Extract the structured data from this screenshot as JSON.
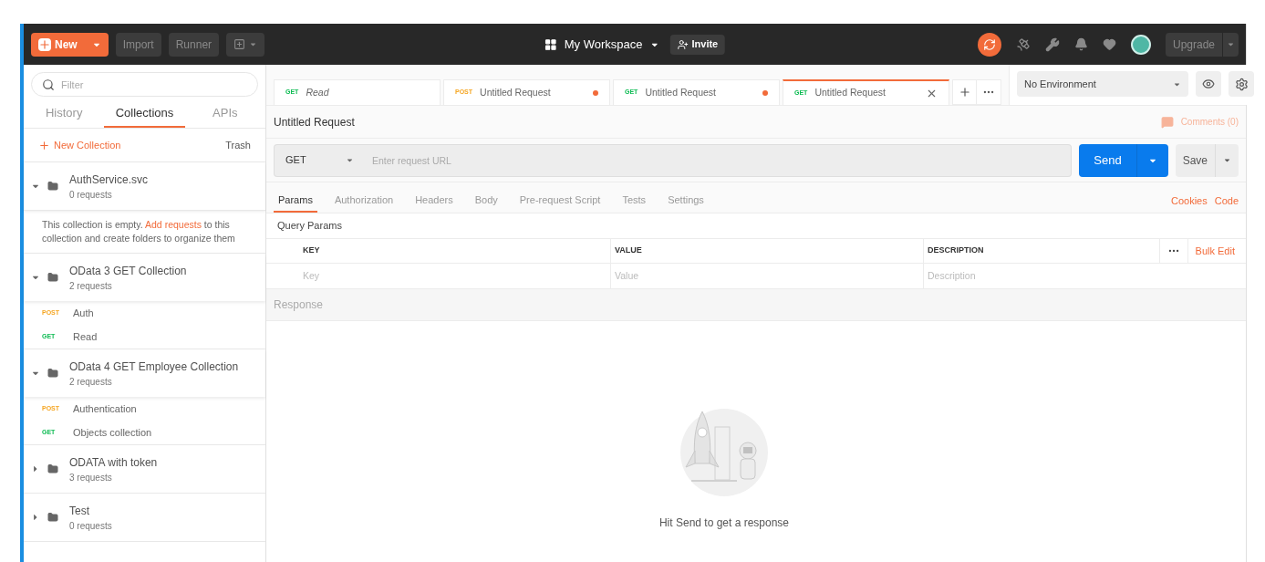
{
  "toolbar": {
    "new_button": "New",
    "buttons": [
      "Import",
      "Runner"
    ],
    "workspace": "My Workspace",
    "invite": "Invite",
    "upgrade": "Upgrade"
  },
  "sidebar": {
    "filter_placeholder": "Filter",
    "tabs": [
      {
        "label": "History",
        "selected": false
      },
      {
        "label": "Collections",
        "selected": true
      },
      {
        "label": "APIs",
        "selected": false
      }
    ],
    "new_collection": "New Collection",
    "trash": "Trash",
    "collections": [
      {
        "name": "AuthService.svc",
        "count": "0 requests",
        "expanded": true,
        "empty_message": {
          "before": "This collection is empty.",
          "link": "Add requests",
          "after": "to this collection and create folders to organize them"
        }
      },
      {
        "name": "OData 3 GET Collection",
        "count": "2 requests",
        "expanded": true,
        "requests": [
          {
            "method": "POST",
            "name": "Auth"
          },
          {
            "method": "GET",
            "name": "Read"
          }
        ]
      },
      {
        "name": "OData 4 GET Employee Collection",
        "count": "2 requests",
        "expanded": true,
        "requests": [
          {
            "method": "POST",
            "name": "Authentication"
          },
          {
            "method": "GET",
            "name": "Objects collection"
          }
        ]
      },
      {
        "name": "ODATA with token",
        "count": "3 requests",
        "expanded": false
      },
      {
        "name": "Test",
        "count": "0 requests",
        "expanded": false
      }
    ]
  },
  "request_tabs": [
    {
      "method": "GET",
      "title": "Read",
      "preview": true,
      "unsaved": false,
      "selected": false
    },
    {
      "method": "POST",
      "title": "Untitled Request",
      "preview": false,
      "unsaved": true,
      "selected": false
    },
    {
      "method": "GET",
      "title": "Untitled Request",
      "preview": false,
      "unsaved": true,
      "selected": false
    },
    {
      "method": "GET",
      "title": "Untitled Request",
      "preview": false,
      "unsaved": false,
      "selected": true
    }
  ],
  "environment": "No Environment",
  "request": {
    "title": "Untitled Request",
    "comments": "Comments (0)",
    "method": "GET",
    "url_placeholder": "Enter request URL",
    "send": "Send",
    "save": "Save",
    "tabs": [
      {
        "label": "Params",
        "selected": true
      },
      {
        "label": "Authorization",
        "selected": false
      },
      {
        "label": "Headers",
        "selected": false
      },
      {
        "label": "Body",
        "selected": false
      },
      {
        "label": "Pre-request Script",
        "selected": false
      },
      {
        "label": "Tests",
        "selected": false
      },
      {
        "label": "Settings",
        "selected": false
      }
    ],
    "links": [
      "Cookies",
      "Code"
    ],
    "query_params": {
      "title": "Query Params",
      "columns": [
        "KEY",
        "VALUE",
        "DESCRIPTION"
      ],
      "bulk_edit": "Bulk Edit",
      "placeholders": [
        "Key",
        "Value",
        "Description"
      ]
    }
  },
  "response": {
    "title": "Response",
    "hint": "Hit Send to get a response"
  }
}
